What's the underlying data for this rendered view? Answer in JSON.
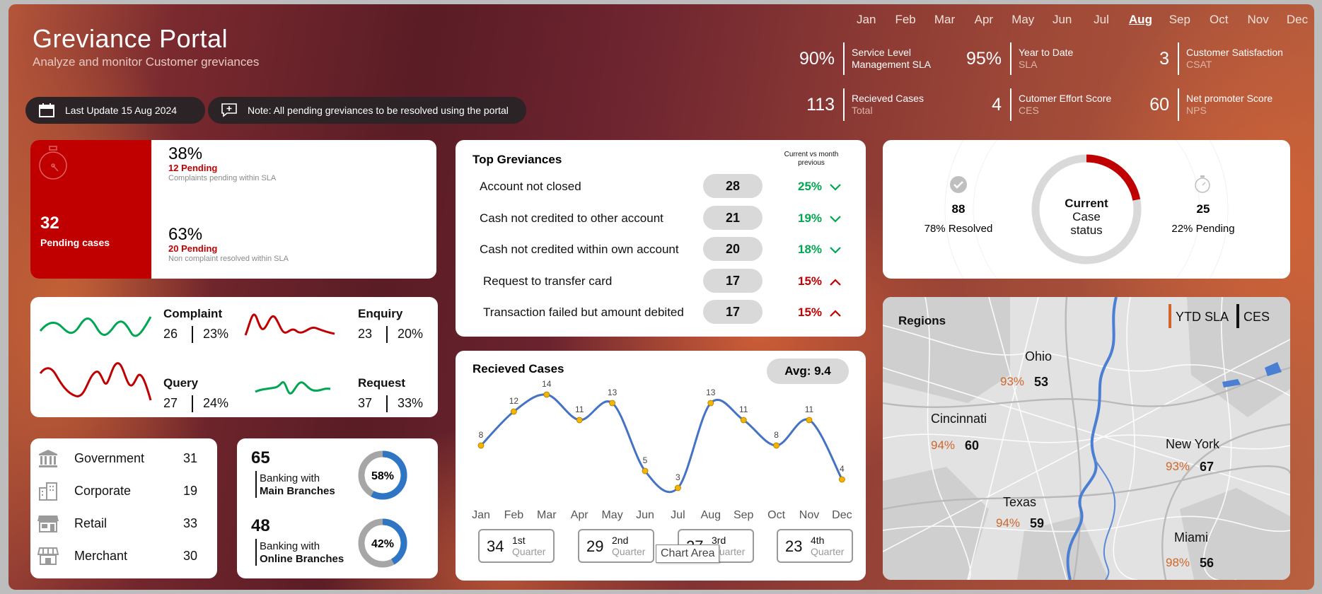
{
  "header": {
    "title": "Greviance Portal",
    "subtitle": "Analyze and monitor Customer greviances",
    "last_update": "Last Update 15 Aug 2024",
    "note": "Note: All pending greviances to be resolved using the portal"
  },
  "months": [
    "Jan",
    "Feb",
    "Mar",
    "Apr",
    "May",
    "Jun",
    "Jul",
    "Aug",
    "Sep",
    "Oct",
    "Nov",
    "Dec"
  ],
  "selected_month": "Aug",
  "kpis": [
    {
      "value": "90%",
      "title": "Service Level",
      "sub": "Management SLA",
      "sub_muted": false
    },
    {
      "value": "95%",
      "title": "Year to Date",
      "sub": "SLA",
      "sub_muted": true
    },
    {
      "value": "3",
      "title": "Customer Satisfaction",
      "sub": "CSAT",
      "sub_muted": true
    },
    {
      "value": "113",
      "title": "Recieved Cases",
      "sub": "Total",
      "sub_muted": true
    },
    {
      "value": "4",
      "title": "Cutomer Effort Score",
      "sub": "CES",
      "sub_muted": true
    },
    {
      "value": "60",
      "title": "Net promoter Score",
      "sub": "NPS",
      "sub_muted": true
    }
  ],
  "pending": {
    "count": "32",
    "label": "Pending cases",
    "a_pct": "38%",
    "a_count": "12 Pending",
    "a_desc": "Complaints pending within SLA",
    "b_pct": "63%",
    "b_count": "20 Pending",
    "b_desc": "Non complaint resolved within SLA"
  },
  "types": [
    {
      "name": "Complaint",
      "count": "26",
      "pct": "23%",
      "color": "#00a651"
    },
    {
      "name": "Enquiry",
      "count": "23",
      "pct": "20%",
      "color": "#c00000"
    },
    {
      "name": "Query",
      "count": "27",
      "pct": "24%",
      "color": "#c00000"
    },
    {
      "name": "Request",
      "count": "37",
      "pct": "33%",
      "color": "#00a651"
    }
  ],
  "categories": [
    {
      "name": "Government",
      "count": "31",
      "icon": "bank-icon"
    },
    {
      "name": "Corporate",
      "count": "19",
      "icon": "building-icon"
    },
    {
      "name": "Retail",
      "count": "33",
      "icon": "store-icon"
    },
    {
      "name": "Merchant",
      "count": "30",
      "icon": "shop-icon"
    }
  ],
  "branches": [
    {
      "count": "65",
      "label1": "Banking with",
      "label2": "Main Branches",
      "pct": "58%",
      "fraction": 0.58
    },
    {
      "count": "48",
      "label1": "Banking with",
      "label2": "Online Branches",
      "pct": "42%",
      "fraction": 0.42
    }
  ],
  "top_grievances": {
    "title": "Top Greviances",
    "col_header": "Current vs month previous",
    "rows": [
      {
        "label": "Account not closed",
        "count": "28",
        "pct": "25%",
        "trend": "down"
      },
      {
        "label": "Cash not credited to other account",
        "count": "21",
        "pct": "19%",
        "trend": "down"
      },
      {
        "label": "Cash not credited within own account",
        "count": "20",
        "pct": "18%",
        "trend": "down"
      },
      {
        "label": "Request to transfer card",
        "count": "17",
        "pct": "15%",
        "trend": "up"
      },
      {
        "label": "Transaction failed but amount debited",
        "count": "17",
        "pct": "15%",
        "trend": "up"
      }
    ]
  },
  "case_status": {
    "title_line1": "Current",
    "title_line2": "Case",
    "title_line3": "status",
    "resolved_count": "88",
    "resolved_label": "78% Resolved",
    "pending_count": "25",
    "pending_label": "22% Pending",
    "pending_fraction": 0.22
  },
  "received_cases": {
    "title": "Recieved Cases",
    "avg": "Avg: 9.4",
    "tooltip": "Chart Area",
    "quarters": [
      {
        "value": "34",
        "line1": "1st",
        "line2": "Quarter"
      },
      {
        "value": "29",
        "line1": "2nd",
        "line2": "Quarter"
      },
      {
        "value": "27",
        "line1": "3rd",
        "line2": "Quarter"
      },
      {
        "value": "23",
        "line1": "4th",
        "line2": "Quarter"
      }
    ]
  },
  "chart_data": {
    "type": "line",
    "categories": [
      "Jan",
      "Feb",
      "Mar",
      "Apr",
      "May",
      "Jun",
      "Jul",
      "Aug",
      "Sep",
      "Oct",
      "Nov",
      "Dec"
    ],
    "values": [
      8,
      12,
      14,
      11,
      13,
      5,
      3,
      13,
      11,
      8,
      11,
      4
    ],
    "title": "Recieved Cases",
    "ylim": [
      0,
      15
    ]
  },
  "regions": {
    "title": "Regions",
    "legend": [
      {
        "label": "YTD SLA",
        "color": "#d0662a"
      },
      {
        "label": "CES",
        "color": "#111111"
      }
    ],
    "items": [
      {
        "name": "Ohio",
        "sla": "93%",
        "ces": "53"
      },
      {
        "name": "Cincinnati",
        "sla": "94%",
        "ces": "60"
      },
      {
        "name": "New York",
        "sla": "93%",
        "ces": "67"
      },
      {
        "name": "Texas",
        "sla": "94%",
        "ces": "59"
      },
      {
        "name": "Miami",
        "sla": "98%",
        "ces": "56"
      }
    ]
  }
}
